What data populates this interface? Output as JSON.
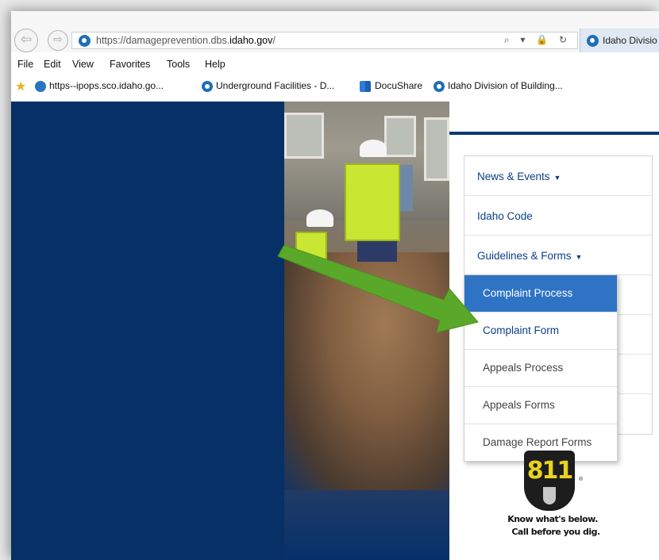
{
  "browser": {
    "url_prefix": "https://damageprevention.dbs.",
    "url_domain": "idaho.gov",
    "url_suffix": "/",
    "tab_title": "Idaho Divisio",
    "url_tools": "⌕ ▾ 🔒 ↻"
  },
  "menu_bar": [
    "File",
    "Edit",
    "View",
    "Favorites",
    "Tools",
    "Help"
  ],
  "favorites": {
    "links": [
      "https--ipops.sco.idaho.go...",
      "Underground Facilities - D...",
      "DocuShare",
      "Idaho Division of Building..."
    ]
  },
  "nav": {
    "news": "News & Events",
    "code": "Idaho Code",
    "guidelines": "Guidelines & Forms",
    "caret": "▼"
  },
  "submenu": {
    "items": [
      "Complaint Process",
      "Complaint Form",
      "Appeals Process",
      "Appeals Forms",
      "Damage Report Forms"
    ]
  },
  "logo": {
    "number": "811",
    "reg": "®",
    "line1": "Know what's below.",
    "line2": "Call before you dig."
  },
  "colors": {
    "navy": "#063066",
    "active_item": "#2f73c4",
    "link_blue": "#0b3f88",
    "arrow_green": "#5aa82a"
  }
}
